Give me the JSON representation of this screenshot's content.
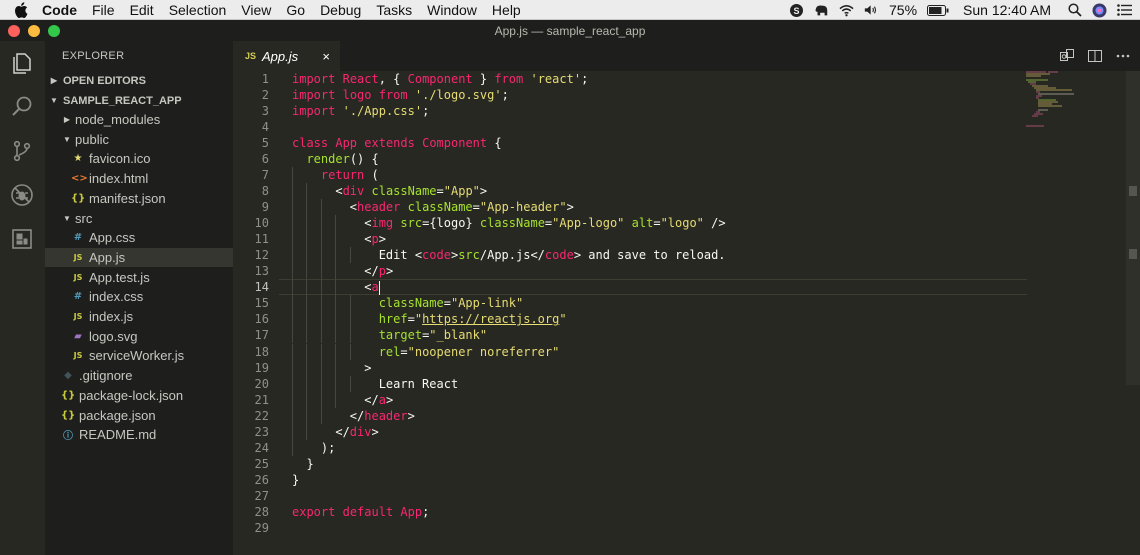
{
  "menubar": {
    "app_name": "Code",
    "items": [
      "File",
      "Edit",
      "Selection",
      "View",
      "Go",
      "Debug",
      "Tasks",
      "Window",
      "Help"
    ],
    "battery": "75%",
    "clock": "Sun 12:40 AM"
  },
  "window": {
    "title": "App.js — sample_react_app"
  },
  "activity_bar": [
    "explorer-icon",
    "search-icon",
    "source-control-icon",
    "debug-icon",
    "extensions-icon"
  ],
  "sidebar": {
    "title": "EXPLORER",
    "open_editors": "OPEN EDITORS",
    "project": "SAMPLE_REACT_APP",
    "tree": [
      {
        "label": "node_modules",
        "kind": "folder-closed"
      },
      {
        "label": "public",
        "kind": "folder-open"
      },
      {
        "label": "favicon.ico",
        "kind": "star"
      },
      {
        "label": "index.html",
        "kind": "html"
      },
      {
        "label": "manifest.json",
        "kind": "json"
      },
      {
        "label": "src",
        "kind": "folder-open"
      },
      {
        "label": "App.css",
        "kind": "css"
      },
      {
        "label": "App.js",
        "kind": "js"
      },
      {
        "label": "App.test.js",
        "kind": "js"
      },
      {
        "label": "index.css",
        "kind": "css"
      },
      {
        "label": "index.js",
        "kind": "js"
      },
      {
        "label": "logo.svg",
        "kind": "svg"
      },
      {
        "label": "serviceWorker.js",
        "kind": "js"
      },
      {
        "label": ".gitignore",
        "kind": "git"
      },
      {
        "label": "package-lock.json",
        "kind": "json"
      },
      {
        "label": "package.json",
        "kind": "json"
      },
      {
        "label": "README.md",
        "kind": "info"
      }
    ]
  },
  "tab": {
    "badge": "JS",
    "label": "App.js",
    "close": "×"
  },
  "editor": {
    "current_line": 14,
    "lines": [
      "import React, { Component } from 'react';",
      "import logo from './logo.svg';",
      "import './App.css';",
      "",
      "class App extends Component {",
      "  render() {",
      "    return (",
      "      <div className=\"App\">",
      "        <header className=\"App-header\">",
      "          <img src={logo} className=\"App-logo\" alt=\"logo\" />",
      "          <p>",
      "            Edit <code>src/App.js</code> and save to reload.",
      "          </p>",
      "          <a",
      "            className=\"App-link\"",
      "            href=\"https://reactjs.org\"",
      "            target=\"_blank\"",
      "            rel=\"noopener noreferrer\"",
      "          >",
      "            Learn React",
      "          </a>",
      "        </header>",
      "      </div>",
      "    );",
      "  }",
      "}",
      "",
      "export default App;",
      ""
    ]
  },
  "colors": {
    "keyword": "#f92672",
    "string": "#e6db74",
    "class": "#a6e22e",
    "text": "#f8f8f2",
    "background": "#272822"
  }
}
